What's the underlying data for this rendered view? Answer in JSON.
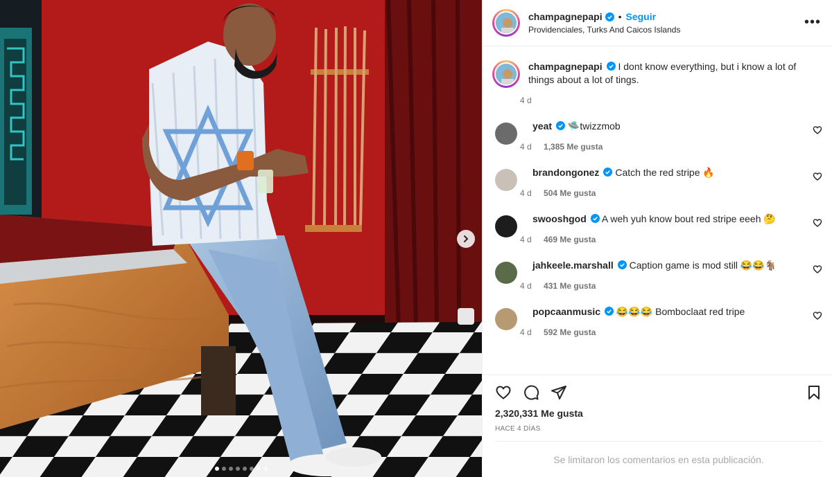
{
  "post": {
    "username": "champagnepapi",
    "follow_label": "Seguir",
    "separator": "•",
    "location": "Providenciales, Turks And Caicos Islands",
    "more_label": "•••",
    "caption_text": "I dont know everything, but i know a lot of things about a lot of tings.",
    "caption_age": "4 d"
  },
  "comments": [
    {
      "username": "yeat",
      "text": "🛸twizzmob",
      "age": "4 d",
      "likes": "1,385 Me gusta",
      "avatar_color": "#6b6b6b"
    },
    {
      "username": "brandongonez",
      "text": "Catch the red stripe 🔥",
      "age": "4 d",
      "likes": "504 Me gusta",
      "avatar_color": "#c9c0b8"
    },
    {
      "username": "swooshgod",
      "text": "A weh yuh know bout red stripe eeeh 🤔",
      "age": "4 d",
      "likes": "469 Me gusta",
      "avatar_color": "#1d1d1d"
    },
    {
      "username": "jahkeele.marshall",
      "text": "Caption game is mod still 😂😂🐐",
      "age": "4 d",
      "likes": "431 Me gusta",
      "avatar_color": "#5a6b4a"
    },
    {
      "username": "popcaanmusic",
      "text": "😂😂😂 Bomboclaat red tripe",
      "age": "4 d",
      "likes": "592 Me gusta",
      "avatar_color": "#b59a72"
    }
  ],
  "footer": {
    "likes": "2,320,331 Me gusta",
    "posted_ago": "HACE 4 DÍAS",
    "comments_limited": "Se limitaron los comentarios en esta publicación."
  },
  "carousel": {
    "total": 8,
    "active_index": 0
  },
  "colors": {
    "accent": "#0095f6",
    "verified": "#0095f6",
    "wall": "#b01818",
    "muted": "#737373"
  },
  "icons": [
    "verified-badge-icon",
    "more-options-icon",
    "heart-icon",
    "comment-icon",
    "share-icon",
    "bookmark-icon",
    "chevron-right-icon"
  ]
}
